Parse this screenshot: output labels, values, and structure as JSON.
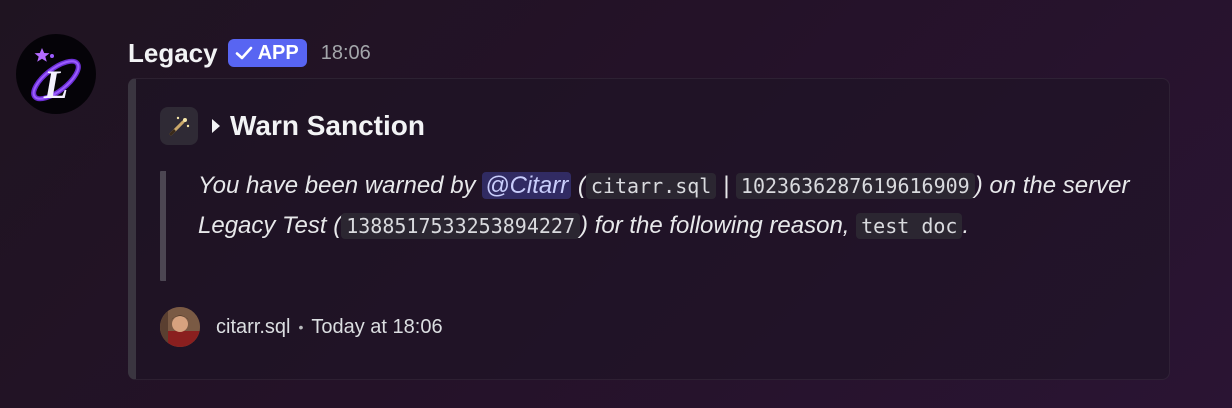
{
  "message": {
    "author": "Legacy",
    "badge_label": "APP",
    "timestamp": "18:06"
  },
  "embed": {
    "title": "Warn Sanction",
    "body": {
      "text1": "You have been warned by ",
      "mention": "@Citarr",
      "text2": " (",
      "code_user": "citarr.sql",
      "sep": " | ",
      "code_user_id": "1023636287619616909",
      "text3": ") on the server Legacy Test (",
      "code_server_id": "1388517533253894227",
      "text4": ") for the following reason, ",
      "code_reason": "test doc",
      "text5": "."
    },
    "footer": {
      "user": "citarr.sql",
      "separator": "•",
      "time": "Today at 18:06"
    }
  },
  "icons": {
    "avatar": "legacy-logo-icon",
    "badge": "check-icon",
    "title_emoji": "magic-wand-icon",
    "title_caret": "caret-right-icon"
  },
  "colors": {
    "badge": "#5865f2",
    "mention": "#c9cdfb",
    "embed_border": "#3a3540"
  }
}
